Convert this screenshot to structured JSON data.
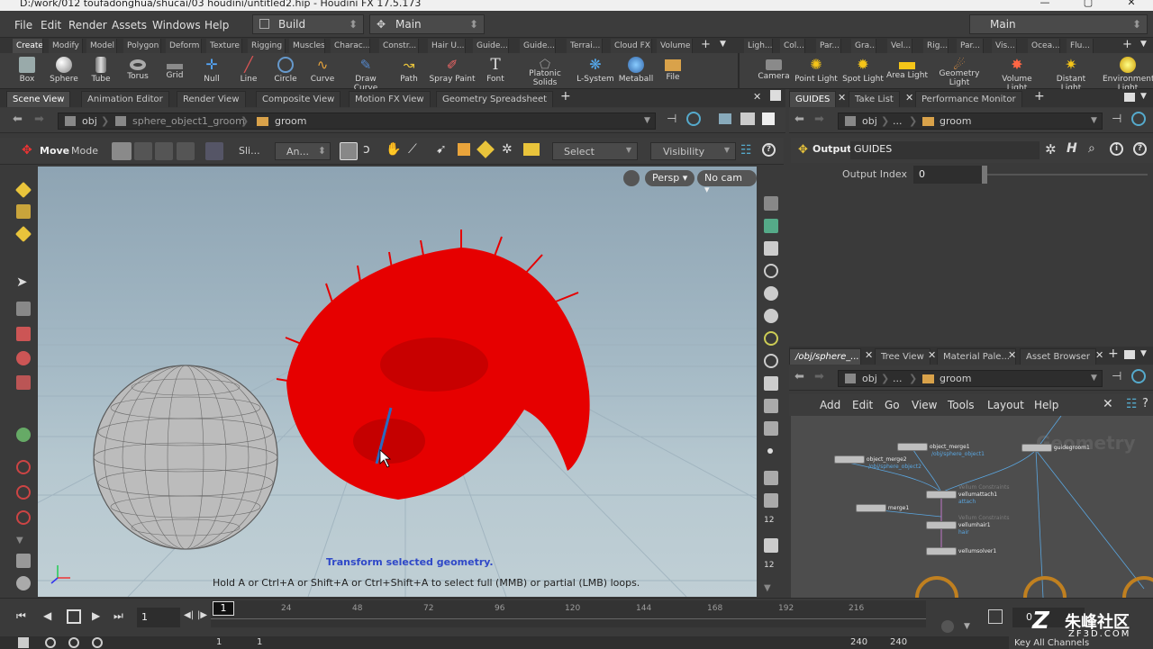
{
  "window": {
    "title": "D:/work/012 toufadonghua/shucai/03 houdini/untitled2.hip - Houdini FX 17.5.173"
  },
  "menu": {
    "items": [
      "File",
      "Edit",
      "Render",
      "Assets",
      "Windows",
      "Help"
    ],
    "desktop": "Build",
    "context": "Main",
    "right_context": "Main"
  },
  "shelf": {
    "tabs_left": [
      "Create",
      "Modify",
      "Model",
      "Polygon",
      "Deform",
      "Texture",
      "Rigging",
      "Muscles",
      "Charac...",
      "Constr...",
      "Hair U...",
      "Guide...",
      "Guide...",
      "Terrai...",
      "Cloud FX",
      "Volume"
    ],
    "tabs_right": [
      "Ligh...",
      "Col...",
      "Par...",
      "Gra...",
      "Vel...",
      "Rig...",
      "Par...",
      "Vis...",
      "Ocea...",
      "Flu..."
    ],
    "tools_left": [
      "Box",
      "Sphere",
      "Tube",
      "Torus",
      "Grid",
      "Null",
      "Line",
      "Circle",
      "Curve",
      "Draw Curve",
      "Path",
      "Spray Paint",
      "Font",
      "Platonic Solids",
      "L-System",
      "Metaball",
      "File"
    ],
    "tools_right": [
      "Camera",
      "Point Light",
      "Spot Light",
      "Area Light",
      "Geometry Light",
      "Volume Light",
      "Distant Light",
      "Environment Light"
    ]
  },
  "left_pane": {
    "tabs": [
      "Scene View",
      "Animation Editor",
      "Render View",
      "Composite View",
      "Motion FX View",
      "Geometry Spreadsheet"
    ],
    "path": {
      "root": "obj",
      "object": "sphere_object1_groom",
      "node": "groom"
    },
    "toolbar": {
      "tool": "Move",
      "mode": "Mode",
      "sli": "Sli...",
      "an": "An...",
      "select": "Select",
      "visibility": "Visibility"
    },
    "viewport": {
      "camera": "Persp",
      "cam": "No cam",
      "hint_title": "Transform selected geometry.",
      "hint_text": "Hold A or Ctrl+A or Shift+A or Ctrl+Shift+A to select full (MMB) or partial (LMB) loops."
    }
  },
  "param_pane": {
    "tabs": [
      "GUIDES",
      "Take List",
      "Performance Monitor"
    ],
    "path": {
      "root": "obj",
      "ellipsis": "...",
      "node": "groom"
    },
    "node_type": "Output",
    "node_name": "GUIDES",
    "param_label": "Output Index",
    "param_value": "0"
  },
  "network_pane": {
    "tabs": [
      "/obj/sphere_...",
      "Tree View",
      "Material Pale...",
      "Asset Browser"
    ],
    "path": {
      "root": "obj",
      "ellipsis": "...",
      "node": "groom"
    },
    "menu": [
      "Add",
      "Edit",
      "Go",
      "View",
      "Tools",
      "Layout",
      "Help"
    ],
    "watermark": "Geometry",
    "nodes": [
      {
        "name": "object_merge1",
        "sub": "/obj/sphere_object1"
      },
      {
        "name": "object_merge2",
        "sub": "/obj/sphere_object2"
      },
      {
        "name": "guidegroom1",
        "sub": ""
      },
      {
        "name": "vellumattach1",
        "sub": "attach",
        "type": "Vellum Constraints"
      },
      {
        "name": "merge1",
        "sub": ""
      },
      {
        "name": "vellumhair1",
        "sub": "hair",
        "type": "Vellum Constraints"
      },
      {
        "name": "vellumsolver1",
        "sub": ""
      }
    ]
  },
  "timeline": {
    "frame": "1",
    "current": "1",
    "ticks": [
      "24",
      "48",
      "72",
      "96",
      "120",
      "144",
      "168",
      "192",
      "216"
    ],
    "start": "1",
    "start2": "1",
    "end": "240",
    "end2": "240",
    "keys": "Key All Channels",
    "sub": "0"
  },
  "watermark": {
    "cn": "朱峰社区",
    "url": "ZF3D.COM"
  }
}
